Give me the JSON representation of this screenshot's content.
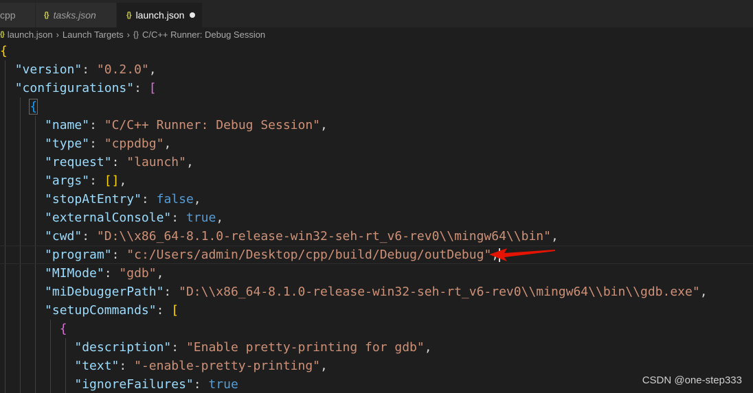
{
  "tabs": [
    {
      "label": "cpp",
      "active": false,
      "italic": false
    },
    {
      "label": "tasks.json",
      "active": false,
      "italic": true
    },
    {
      "label": "launch.json",
      "active": true,
      "modified": true
    }
  ],
  "breadcrumb": [
    "launch.json",
    "Launch Targets",
    "C/C++ Runner: Debug Session"
  ],
  "code": {
    "version_key": "\"version\"",
    "version_val": "\"0.2.0\"",
    "configurations_key": "\"configurations\"",
    "name_key": "\"name\"",
    "name_val": "\"C/C++ Runner: Debug Session\"",
    "type_key": "\"type\"",
    "type_val": "\"cppdbg\"",
    "request_key": "\"request\"",
    "request_val": "\"launch\"",
    "args_key": "\"args\"",
    "stopAtEntry_key": "\"stopAtEntry\"",
    "stopAtEntry_val": "false",
    "externalConsole_key": "\"externalConsole\"",
    "externalConsole_val": "true",
    "cwd_key": "\"cwd\"",
    "cwd_val": "\"D:\\\\x86_64-8.1.0-release-win32-seh-rt_v6-rev0\\\\mingw64\\\\bin\"",
    "program_key": "\"program\"",
    "program_val": "\"c:/Users/admin/Desktop/cpp/build/Debug/outDebug\"",
    "MIMode_key": "\"MIMode\"",
    "MIMode_val": "\"gdb\"",
    "miDebuggerPath_key": "\"miDebuggerPath\"",
    "miDebuggerPath_val": "\"D:\\\\x86_64-8.1.0-release-win32-seh-rt_v6-rev0\\\\mingw64\\\\bin\\\\gdb.exe\"",
    "setupCommands_key": "\"setupCommands\"",
    "description_key": "\"description\"",
    "description_val": "\"Enable pretty-printing for gdb\"",
    "text_key": "\"text\"",
    "text_val": "\"-enable-pretty-printing\"",
    "ignoreFailures_key": "\"ignoreFailures\"",
    "ignoreFailures_val": "true"
  },
  "watermark": "CSDN @one-step333",
  "colors": {
    "background": "#1e1e1e",
    "key": "#9cdcfe",
    "string": "#ce9178",
    "boolean": "#569cd6",
    "arrow": "#e51400"
  }
}
